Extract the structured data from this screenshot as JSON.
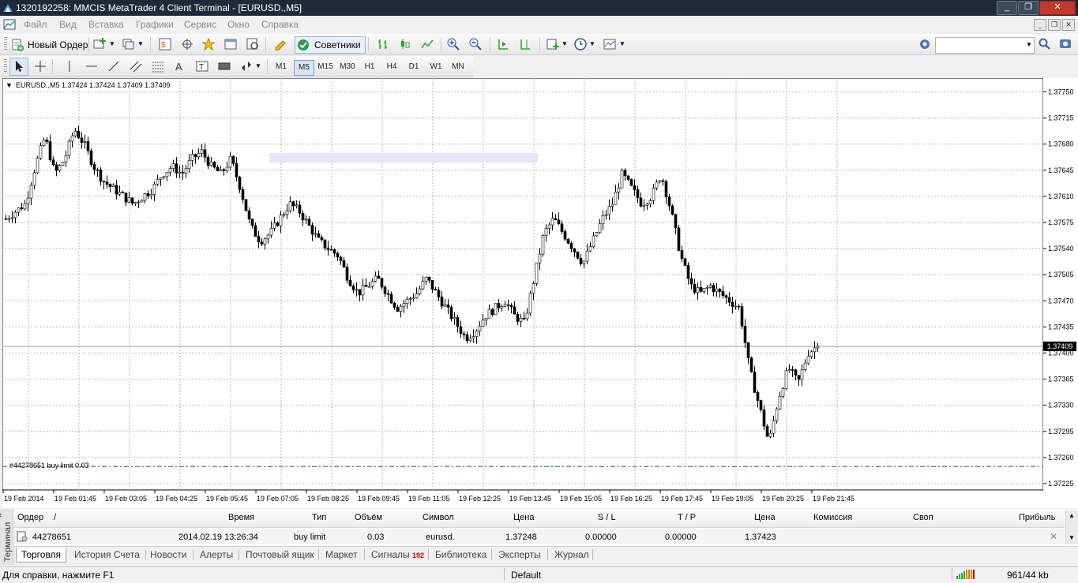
{
  "window": {
    "title": "1320192258: MMCIS MetaTrader 4 Client Terminal - [EURUSD.,M5]"
  },
  "menu": {
    "items": [
      "Файл",
      "Вид",
      "Вставка",
      "Графики",
      "Сервис",
      "Окно",
      "Справка"
    ]
  },
  "toolbar": {
    "new_order": "Новый Ордер",
    "experts": "Советники",
    "search_placeholder": ""
  },
  "timeframes": {
    "items": [
      "M1",
      "M5",
      "M15",
      "M30",
      "H1",
      "H4",
      "D1",
      "W1",
      "MN"
    ],
    "selected": "M5"
  },
  "chart": {
    "header": "EURUSD.,M5  1.37424 1.37424 1.37409 1.37409",
    "current_price": "1.37409",
    "order_line_label": "#44278651 buy limit 0.03",
    "price_ticks": [
      "1.37750",
      "1.37715",
      "1.37680",
      "1.37645",
      "1.37610",
      "1.37575",
      "1.37540",
      "1.37505",
      "1.37470",
      "1.37435",
      "1.37400",
      "1.37365",
      "1.37330",
      "1.37295",
      "1.37260",
      "1.37225"
    ],
    "time_ticks": [
      "19 Feb 2014",
      "19 Feb 01:45",
      "19 Feb 03:05",
      "19 Feb 04:25",
      "19 Feb 05:45",
      "19 Feb 07:05",
      "19 Feb 08:25",
      "19 Feb 09:45",
      "19 Feb 11:05",
      "19 Feb 12:25",
      "19 Feb 13:45",
      "19 Feb 15:05",
      "19 Feb 16:25",
      "19 Feb 17:45",
      "19 Feb 19:05",
      "19 Feb 20:25",
      "19 Feb 21:45"
    ]
  },
  "chart_data": {
    "type": "candlestick",
    "symbol": "EURUSD.",
    "timeframe": "M5",
    "ylim": [
      1.37225,
      1.3776
    ],
    "last": {
      "open": 1.37424,
      "high": 1.37424,
      "low": 1.37409,
      "close": 1.37409
    },
    "close_path": [
      1.3758,
      1.3759,
      1.376,
      1.3765,
      1.3769,
      1.3764,
      1.3766,
      1.377,
      1.3768,
      1.3765,
      1.3763,
      1.3762,
      1.3761,
      1.376,
      1.3761,
      1.3762,
      1.3764,
      1.3765,
      1.3764,
      1.3766,
      1.3767,
      1.3765,
      1.3764,
      1.3766,
      1.3762,
      1.3757,
      1.3755,
      1.3756,
      1.3758,
      1.376,
      1.3759,
      1.3757,
      1.3755,
      1.3754,
      1.3753,
      1.375,
      1.3748,
      1.3749,
      1.375,
      1.3748,
      1.3746,
      1.3747,
      1.3748,
      1.375,
      1.3748,
      1.3746,
      1.3744,
      1.3742,
      1.3743,
      1.3745,
      1.3746,
      1.3747,
      1.3745,
      1.3744,
      1.375,
      1.3756,
      1.3758,
      1.3756,
      1.3754,
      1.3752,
      1.3755,
      1.3758,
      1.376,
      1.3764,
      1.3762,
      1.376,
      1.3761,
      1.3764,
      1.3759,
      1.3753,
      1.3749,
      1.3748,
      1.3749,
      1.3748,
      1.3747,
      1.3746,
      1.3738,
      1.3733,
      1.3728,
      1.3734,
      1.3738,
      1.3736,
      1.374,
      1.3741
    ],
    "pending_order": {
      "ticket": "44278651",
      "type": "buy limit",
      "volume": 0.03,
      "price": 1.37248
    }
  },
  "terminal": {
    "side_label": "Терминал",
    "columns": [
      "Ордер",
      "/",
      "Время",
      "Тип",
      "Объём",
      "Символ",
      "Цена",
      "S / L",
      "T / P",
      "Цена",
      "Комиссия",
      "Своп",
      "Прибыль"
    ],
    "row": {
      "order": "44278651",
      "time": "2014.02.19 13:26:34",
      "type": "buy limit",
      "volume": "0.03",
      "symbol": "eurusd.",
      "price": "1.37248",
      "sl": "0.00000",
      "tp": "0.00000",
      "cur_price": "1.37423"
    },
    "tabs": [
      "Торговля",
      "История Счета",
      "Новости",
      "Алерты",
      "Почтовый ящик",
      "Маркет",
      "Сигналы",
      "Библиотека",
      "Эксперты",
      "Журнал"
    ],
    "signals_badge": "192",
    "active_tab": "Торговля"
  },
  "status": {
    "help": "Для справки, нажмите F1",
    "profile": "Default",
    "traffic": "961/44 kb"
  }
}
